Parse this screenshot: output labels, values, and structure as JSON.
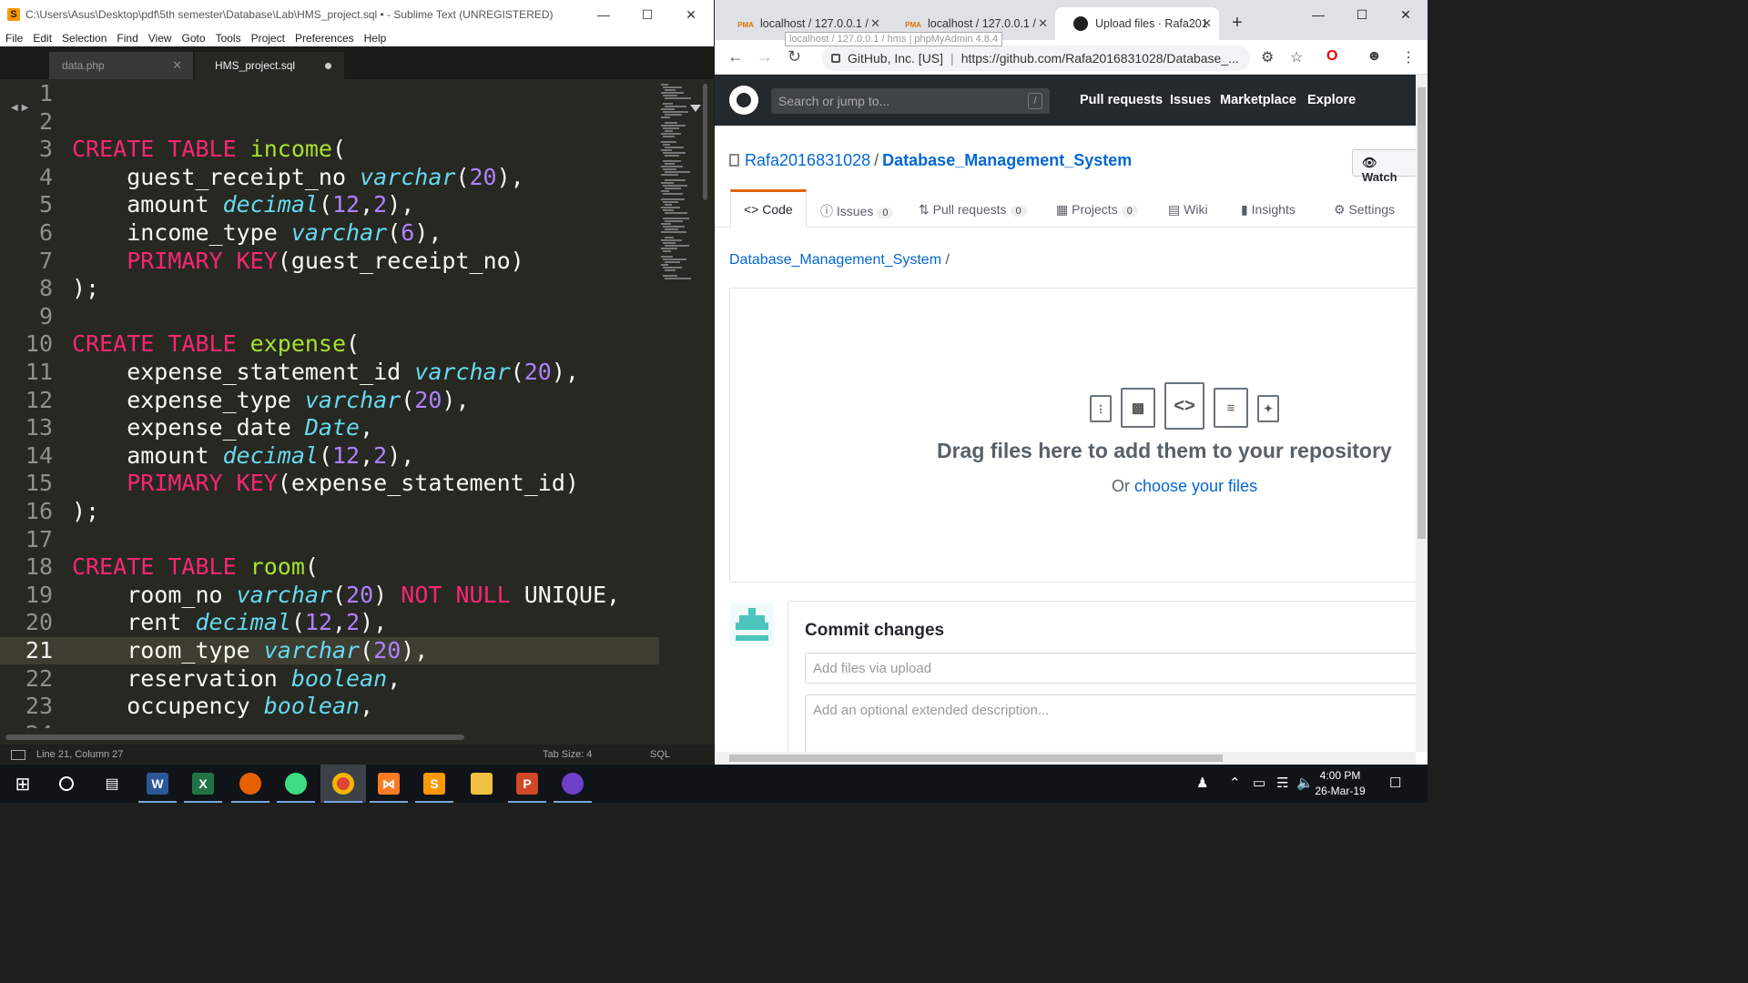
{
  "sublime": {
    "title": "C:\\Users\\Asus\\Desktop\\pdf\\5th semester\\Database\\Lab\\HMS_project.sql • - Sublime Text (UNREGISTERED)",
    "menu": [
      "File",
      "Edit",
      "Selection",
      "Find",
      "View",
      "Goto",
      "Tools",
      "Project",
      "Preferences",
      "Help"
    ],
    "tabs": [
      "data.php",
      "HMS_project.sql"
    ],
    "status": {
      "position": "Line 21, Column 27",
      "tab_size": "Tab Size: 4",
      "syntax": "SQL"
    },
    "current_line": 21,
    "lines": [
      {
        "n": "1",
        "t": []
      },
      {
        "n": "2",
        "t": []
      },
      {
        "n": "3",
        "t": [
          [
            "kw",
            "CREATE TABLE "
          ],
          [
            "fn",
            "income"
          ],
          [
            "p",
            "("
          ]
        ]
      },
      {
        "n": "4",
        "t": [
          [
            "p",
            "    guest_receipt_no "
          ],
          [
            "ty",
            "varchar"
          ],
          [
            "p",
            "("
          ],
          [
            "num",
            "20"
          ],
          [
            "p",
            "),"
          ]
        ]
      },
      {
        "n": "5",
        "t": [
          [
            "p",
            "    amount "
          ],
          [
            "ty",
            "decimal"
          ],
          [
            "p",
            "("
          ],
          [
            "num",
            "12"
          ],
          [
            "p",
            ","
          ],
          [
            "num",
            "2"
          ],
          [
            "p",
            "),"
          ]
        ]
      },
      {
        "n": "6",
        "t": [
          [
            "p",
            "    income_type "
          ],
          [
            "ty",
            "varchar"
          ],
          [
            "p",
            "("
          ],
          [
            "num",
            "6"
          ],
          [
            "p",
            "),"
          ]
        ]
      },
      {
        "n": "7",
        "t": [
          [
            "p",
            "    "
          ],
          [
            "kw",
            "PRIMARY KEY"
          ],
          [
            "p",
            "(guest_receipt_no)"
          ]
        ]
      },
      {
        "n": "8",
        "t": [
          [
            "p",
            ");"
          ]
        ]
      },
      {
        "n": "9",
        "t": []
      },
      {
        "n": "10",
        "t": [
          [
            "kw",
            "CREATE TABLE "
          ],
          [
            "fn",
            "expense"
          ],
          [
            "p",
            "("
          ]
        ]
      },
      {
        "n": "11",
        "t": [
          [
            "p",
            "    expense_statement_id "
          ],
          [
            "ty",
            "varchar"
          ],
          [
            "p",
            "("
          ],
          [
            "num",
            "20"
          ],
          [
            "p",
            "),"
          ]
        ]
      },
      {
        "n": "12",
        "t": [
          [
            "p",
            "    expense_type "
          ],
          [
            "ty",
            "varchar"
          ],
          [
            "p",
            "("
          ],
          [
            "num",
            "20"
          ],
          [
            "p",
            "),"
          ]
        ]
      },
      {
        "n": "13",
        "t": [
          [
            "p",
            "    expense_date "
          ],
          [
            "ty",
            "Date"
          ],
          [
            "p",
            ","
          ]
        ]
      },
      {
        "n": "14",
        "t": [
          [
            "p",
            "    amount "
          ],
          [
            "ty",
            "decimal"
          ],
          [
            "p",
            "("
          ],
          [
            "num",
            "12"
          ],
          [
            "p",
            ","
          ],
          [
            "num",
            "2"
          ],
          [
            "p",
            "),"
          ]
        ]
      },
      {
        "n": "15",
        "t": [
          [
            "p",
            "    "
          ],
          [
            "kw",
            "PRIMARY KEY"
          ],
          [
            "p",
            "(expense_statement_id)"
          ]
        ]
      },
      {
        "n": "16",
        "t": [
          [
            "p",
            ");"
          ]
        ]
      },
      {
        "n": "17",
        "t": []
      },
      {
        "n": "18",
        "t": [
          [
            "kw",
            "CREATE TABLE "
          ],
          [
            "fn",
            "room"
          ],
          [
            "p",
            "("
          ]
        ]
      },
      {
        "n": "19",
        "t": [
          [
            "p",
            "    room_no "
          ],
          [
            "ty",
            "varchar"
          ],
          [
            "p",
            "("
          ],
          [
            "num",
            "20"
          ],
          [
            "p",
            ") "
          ],
          [
            "kw",
            "NOT NULL"
          ],
          [
            "p",
            " UNIQUE,"
          ]
        ]
      },
      {
        "n": "20",
        "t": [
          [
            "p",
            "    rent "
          ],
          [
            "ty",
            "decimal"
          ],
          [
            "p",
            "("
          ],
          [
            "num",
            "12"
          ],
          [
            "p",
            ","
          ],
          [
            "num",
            "2"
          ],
          [
            "p",
            "),"
          ]
        ]
      },
      {
        "n": "21",
        "t": [
          [
            "p",
            "    room_type "
          ],
          [
            "ty",
            "varchar"
          ],
          [
            "p",
            "("
          ],
          [
            "num",
            "20"
          ],
          [
            "p",
            "),"
          ]
        ]
      },
      {
        "n": "22",
        "t": [
          [
            "p",
            "    reservation "
          ],
          [
            "ty",
            "boolean"
          ],
          [
            "p",
            ","
          ]
        ]
      },
      {
        "n": "23",
        "t": [
          [
            "p",
            "    occupency "
          ],
          [
            "ty",
            "boolean"
          ],
          [
            "p",
            ","
          ]
        ]
      },
      {
        "n": "24",
        "t": []
      }
    ]
  },
  "chrome": {
    "tabs": [
      {
        "title": "localhost / 127.0.0.1 /",
        "favicon": "PMA"
      },
      {
        "title": "localhost / 127.0.0.1 /",
        "favicon": "PMA"
      },
      {
        "title": "Upload files · Rafa201",
        "favicon": "github-icon"
      }
    ],
    "tooltip": "localhost / 127.0.0.1 / hms | phpMyAdmin 4.8.4",
    "address": {
      "org": "GitHub, Inc. [US]",
      "url": "https://github.com/Rafa2016831028/Database_..."
    }
  },
  "github": {
    "search_placeholder": "Search or jump to...",
    "search_key": "/",
    "nav": [
      "Pull requests",
      "Issues",
      "Marketplace",
      "Explore"
    ],
    "owner": "Rafa2016831028",
    "repo": "Database_Management_System",
    "watch": "Watch",
    "tabs": [
      {
        "label": "Code",
        "count": "",
        "icon": "code-icon"
      },
      {
        "label": "Issues",
        "count": "0",
        "icon": "issue-icon"
      },
      {
        "label": "Pull requests",
        "count": "0",
        "icon": "pr-icon"
      },
      {
        "label": "Projects",
        "count": "0",
        "icon": "project-icon"
      },
      {
        "label": "Wiki",
        "count": "",
        "icon": "book-icon"
      },
      {
        "label": "Insights",
        "count": "",
        "icon": "graph-icon"
      },
      {
        "label": "Settings",
        "count": "",
        "icon": "gear-icon"
      }
    ],
    "breadcrumb": "Database_Management_System",
    "drop_title": "Drag files here to add them to your repository",
    "drop_or": "Or ",
    "drop_link": "choose your files",
    "commit_title": "Commit changes",
    "commit_summary_placeholder": "Add files via upload",
    "commit_desc_placeholder": "Add an optional extended description..."
  },
  "taskbar": {
    "apps": [
      "windows-start",
      "cortana",
      "task-view",
      "word",
      "excel",
      "firefox",
      "android-studio",
      "chrome",
      "xampp",
      "sublime",
      "file-explorer",
      "powerpoint",
      "github-desktop"
    ],
    "time": "4:00 PM",
    "date": "26-Mar-19"
  },
  "colors": {
    "keyword": "#f92672",
    "type": "#66d9ef",
    "number": "#ae81ff",
    "function": "#a6e22e",
    "link": "#0366d6",
    "tab_accent": "#e36209"
  }
}
